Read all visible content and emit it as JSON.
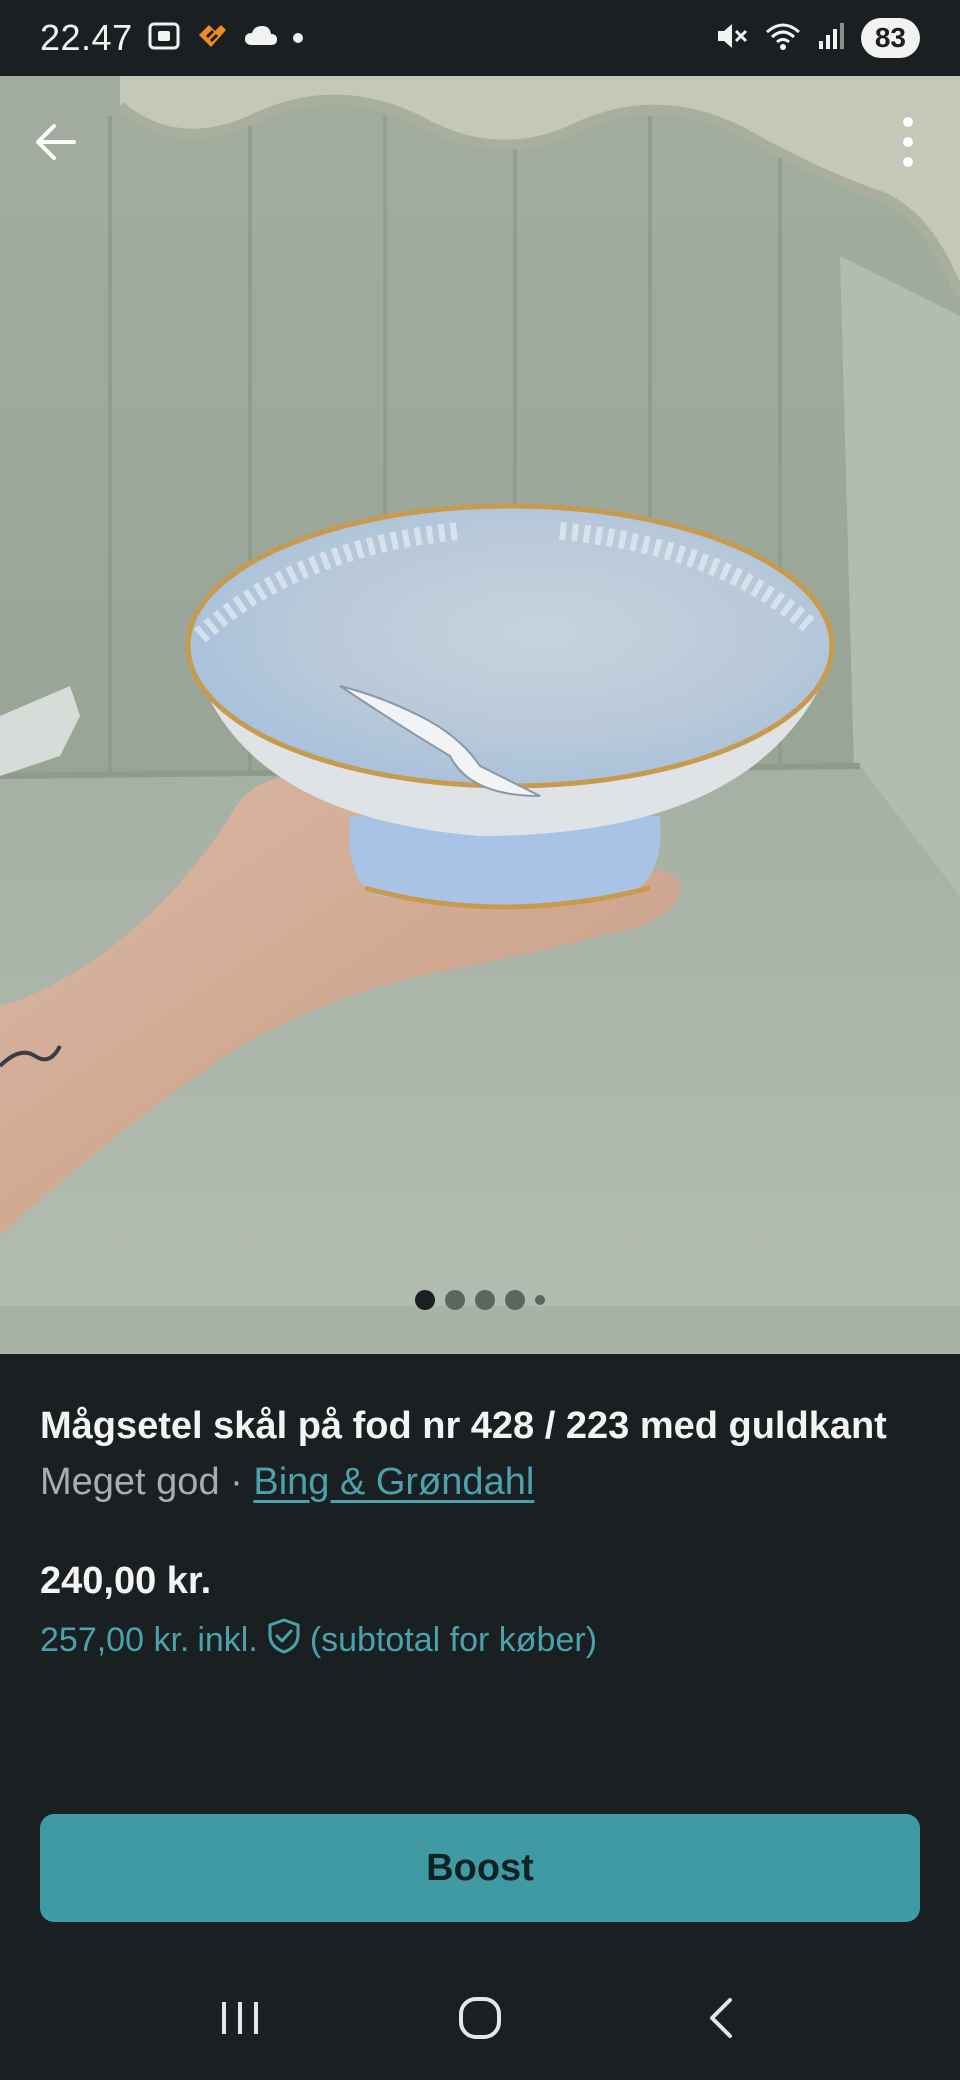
{
  "status_bar": {
    "time": "22.47",
    "battery": "83"
  },
  "listing": {
    "title": "Mågsetel skål på fod nr  428 / 223 med guldkant",
    "condition": "Meget god",
    "separator": " · ",
    "brand": "Bing & Grøndahl",
    "price": "240,00 kr.",
    "price_incl_amount": "257,00 kr.",
    "price_incl_label": "inkl.",
    "price_incl_note": "(subtotal for køber)"
  },
  "gallery": {
    "image_count": 5,
    "active_index": 0
  },
  "actions": {
    "boost_label": "Boost"
  },
  "colors": {
    "background": "#1a1f21",
    "accent": "#4aa3ac",
    "boost_button": "#3f9aa3"
  },
  "icons": {
    "back": "arrow-left-icon",
    "more": "more-vertical-icon",
    "buyer_protection": "shield-check-icon",
    "nav_recents": "recents-icon",
    "nav_home": "home-icon",
    "nav_back": "nav-back-icon"
  }
}
